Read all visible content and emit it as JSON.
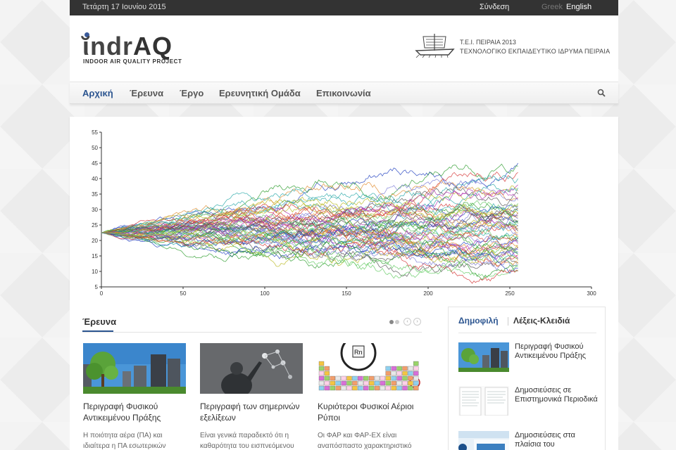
{
  "topbar": {
    "date": "Τετάρτη 17 Ιουνίου 2015",
    "login": "Σύνδεση",
    "lang_greek": "Greek",
    "lang_english": "English"
  },
  "logo": {
    "main_pre": "ῐndr",
    "main_aq": "AQ",
    "subtitle": "INDOOR AIR QUALITY PROJECT"
  },
  "institution": {
    "line1": "Τ.Ε.Ι. ΠΕΙΡΑΙΑ 2013",
    "line2": "ΤΕΧΝΟΛΟΓΙΚΟ ΕΚΠΑΙΔΕΥΤΙΚΟ ΙΔΡΥΜΑ ΠΕΙΡΑΙΑ"
  },
  "nav": {
    "items": [
      "Αρχική",
      "Έρευνα",
      "Έργο",
      "Ερευνητική Ομάδα",
      "Επικοινωνία"
    ],
    "active_index": 0
  },
  "colors": {
    "accent": "#2c5590",
    "topbar": "#333333"
  },
  "chart_data": {
    "type": "line",
    "x_ticks": [
      0,
      50,
      100,
      150,
      200,
      250,
      300
    ],
    "y_ticks": [
      5,
      10,
      15,
      20,
      25,
      30,
      35,
      40,
      45,
      50,
      55
    ],
    "xlim": [
      0,
      300
    ],
    "ylim": [
      5,
      55
    ],
    "steps": 256,
    "start_value": 22.5,
    "series_count": 60,
    "final_values": [
      45,
      44,
      42,
      40,
      38,
      36,
      35,
      34,
      33,
      32,
      31,
      30.5,
      30,
      29.5,
      29,
      28.5,
      28,
      27.5,
      27,
      26.5,
      26,
      25.5,
      25,
      24.5,
      24,
      23.5,
      23,
      22.5,
      22,
      21.5,
      21,
      20.5,
      20,
      19.5,
      19,
      18.5,
      18,
      17.5,
      17,
      16.5,
      16,
      15.5,
      15,
      14.5,
      14,
      13.5,
      13,
      12.5,
      12,
      11.5,
      11,
      10.5,
      10,
      37,
      33.5,
      31.5,
      26.2,
      21.2,
      17.2,
      12.2
    ],
    "grid": false
  },
  "research": {
    "title": "Έρευνα",
    "prev_icon": "chevron-left-icon",
    "next_icon": "chevron-right-icon",
    "cards": [
      {
        "title": "Περιγραφή Φυσικού Αντικειμένου Πράξης",
        "text": "Η ποιότητα αέρα (ΠΑ) και ιδιαίτερα η ΠΑ εσωτερικών χώρων",
        "image": "city-trees-image"
      },
      {
        "title": "Περιγραφή των σημερινών εξελίξεων",
        "text": "Είναι γενικά παραδεκτό ότι η καθαρότητα του εισπνεόμενου",
        "image": "molecule-touch-image"
      },
      {
        "title": "Κυριότεροι Φυσικοί Αέριοι Ρύποι",
        "text": "Οι ΦΑΡ και ΦΑΡ-ΕΧ είναι αναπόσπαστο χαρακτηριστικό",
        "image": "periodic-table-image"
      }
    ]
  },
  "sidebar": {
    "tab_popular": "Δημοφιλή",
    "tab_keywords": "Λέξεις-Κλειδιά",
    "items": [
      {
        "title": "Περιγραφή Φυσικού Αντικειμένου Πράξης",
        "image": "city-trees-thumb"
      },
      {
        "title": "Δημοσιεύσεις σε Επιστημονικά Περιοδικά",
        "image": "document-pages-thumb"
      },
      {
        "title": "Δημοσιεύσεις στα πλαίσια του",
        "image": "era-net-thumb"
      }
    ]
  }
}
